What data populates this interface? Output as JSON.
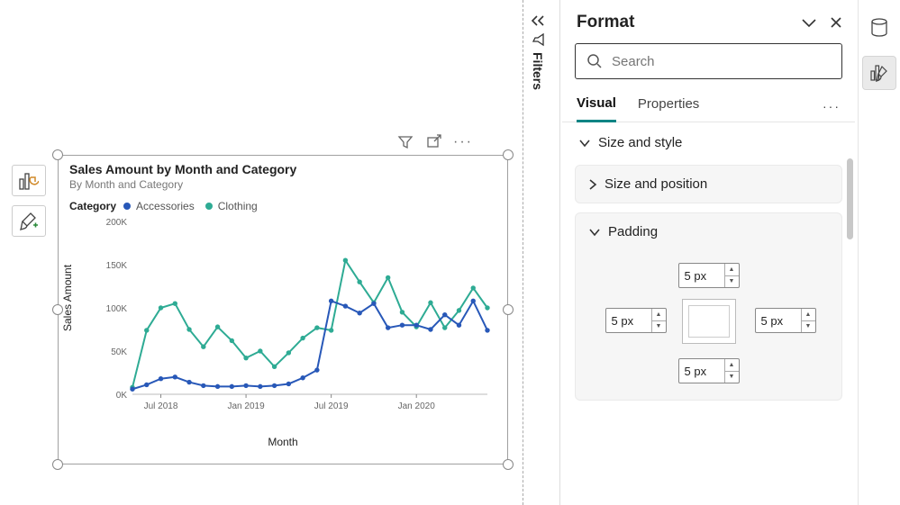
{
  "chart_data": {
    "type": "line",
    "title": "Sales Amount by Month and Category",
    "subtitle": "By Month and Category",
    "xlabel": "Month",
    "ylabel": "Sales Amount",
    "y_ticks": [
      "0K",
      "50K",
      "100K",
      "150K",
      "200K"
    ],
    "x_ticks": [
      "Jul 2018",
      "Jan 2019",
      "Jul 2019",
      "Jan 2020"
    ],
    "ylim": [
      0,
      200
    ],
    "legend_title": "Category",
    "categories": [
      "May 2018",
      "Jun 2018",
      "Jul 2018",
      "Aug 2018",
      "Sep 2018",
      "Oct 2018",
      "Nov 2018",
      "Dec 2018",
      "Jan 2019",
      "Feb 2019",
      "Mar 2019",
      "Apr 2019",
      "May 2019",
      "Jun 2019",
      "Jul 2019",
      "Aug 2019",
      "Sep 2019",
      "Oct 2019",
      "Nov 2019",
      "Dec 2019",
      "Jan 2020",
      "Feb 2020",
      "Mar 2020",
      "Apr 2020",
      "May 2020",
      "Jun 2020"
    ],
    "series": [
      {
        "name": "Accessories",
        "color": "#2858b8",
        "values": [
          6,
          11,
          18,
          20,
          14,
          10,
          9,
          9,
          10,
          9,
          10,
          12,
          19,
          28,
          108,
          102,
          94,
          105,
          77,
          80,
          80,
          75,
          92,
          80,
          108,
          74
        ]
      },
      {
        "name": "Clothing",
        "color": "#2eab94",
        "values": [
          8,
          74,
          100,
          105,
          75,
          55,
          78,
          62,
          42,
          50,
          32,
          48,
          65,
          77,
          74,
          155,
          130,
          106,
          135,
          95,
          78,
          106,
          77,
          97,
          123,
          100
        ]
      }
    ]
  },
  "filters_label": "Filters",
  "pane": {
    "title": "Format",
    "search_placeholder": "Search",
    "tabs": {
      "visual": "Visual",
      "properties": "Properties"
    },
    "sections": {
      "size_style": "Size and style",
      "size_position": "Size and position",
      "padding": "Padding"
    },
    "padding": {
      "top": "5 px",
      "left": "5 px",
      "right": "5 px",
      "bottom": "5 px"
    }
  }
}
